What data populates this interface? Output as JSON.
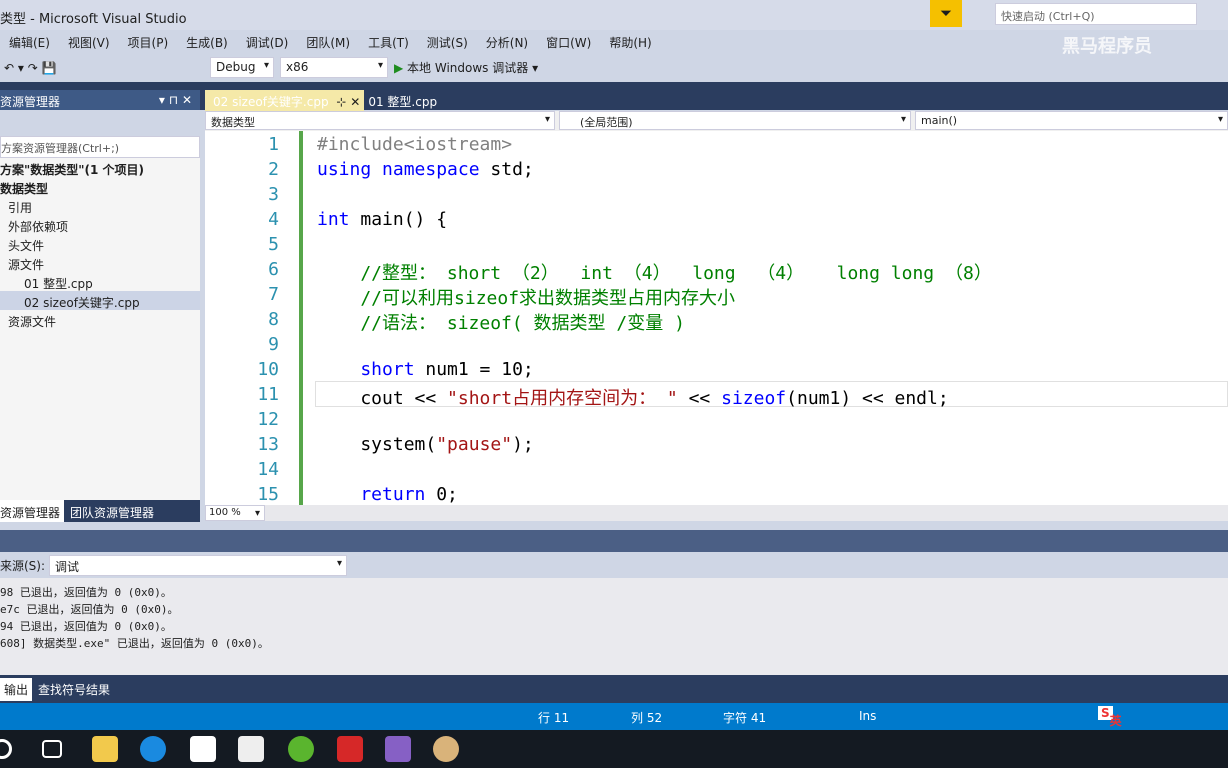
{
  "window": {
    "title": "类型 - Microsoft Visual Studio",
    "quick_launch": "快速启动 (Ctrl+Q)",
    "watermark": "黑马程序员"
  },
  "menu": [
    "编辑(E)",
    "视图(V)",
    "项目(P)",
    "生成(B)",
    "调试(D)",
    "团队(M)",
    "工具(T)",
    "测试(S)",
    "分析(N)",
    "窗口(W)",
    "帮助(H)"
  ],
  "toolbar": {
    "config": "Debug",
    "platform": "x86",
    "run": "本地 Windows 调试器"
  },
  "solution": {
    "title": "资源管理器",
    "search": "方案资源管理器(Ctrl+;)",
    "items": [
      "方案\"数据类型\"(1 个项目)",
      "数据类型",
      "引用",
      "外部依赖项",
      "头文件",
      "源文件",
      "01 整型.cpp",
      "02 sizeof关键字.cpp",
      "资源文件"
    ],
    "tabs": [
      "资源管理器",
      "团队资源管理器"
    ]
  },
  "editor": {
    "tabs": [
      "02 sizeof关键字.cpp",
      "01 整型.cpp"
    ],
    "nav": [
      "数据类型",
      "(全局范围)",
      "main()"
    ],
    "zoom": "100 %",
    "lines": [
      [
        [
          "pp",
          "#include<iostream>"
        ]
      ],
      [
        [
          "kw",
          "using namespace "
        ],
        [
          "",
          "std;"
        ]
      ],
      [],
      [
        [
          "kw",
          "int "
        ],
        [
          "",
          "main() {"
        ]
      ],
      [],
      [
        [
          "cm",
          "    //整型： short （2）  int （4）  long  （4）   long long （8）"
        ]
      ],
      [
        [
          "cm",
          "    //可以利用sizeof求出数据类型占用内存大小"
        ]
      ],
      [
        [
          "cm",
          "    //语法： sizeof( 数据类型 /变量 )"
        ]
      ],
      [],
      [
        [
          "kw",
          "    short "
        ],
        [
          "",
          "num1 = 10;"
        ]
      ],
      [
        [
          "",
          "    cout << "
        ],
        [
          "st",
          "\"short占用内存空间为： \""
        ],
        [
          "",
          " << "
        ],
        [
          "kw",
          "sizeof"
        ],
        [
          "",
          "(num1) << endl;"
        ]
      ],
      [],
      [
        [
          "",
          "    system("
        ],
        [
          "st",
          "\"pause\""
        ],
        [
          "",
          ");"
        ]
      ],
      [],
      [
        [
          "kw",
          "    return "
        ],
        [
          "",
          "0;"
        ]
      ]
    ]
  },
  "output": {
    "source_label": "来源(S):",
    "source": "调试",
    "lines": [
      "98 已退出，返回值为 0 (0x0)。",
      "e7c 已退出，返回值为 0 (0x0)。",
      "94 已退出，返回值为 0 (0x0)。",
      "608] 数据类型.exe\" 已退出，返回值为 0 (0x0)。"
    ],
    "tabs": [
      "输出",
      "查找符号结果"
    ]
  },
  "status": {
    "line": "行 11",
    "col": "列 52",
    "char": "字符 41",
    "mode": "Ins",
    "ime": "英"
  }
}
